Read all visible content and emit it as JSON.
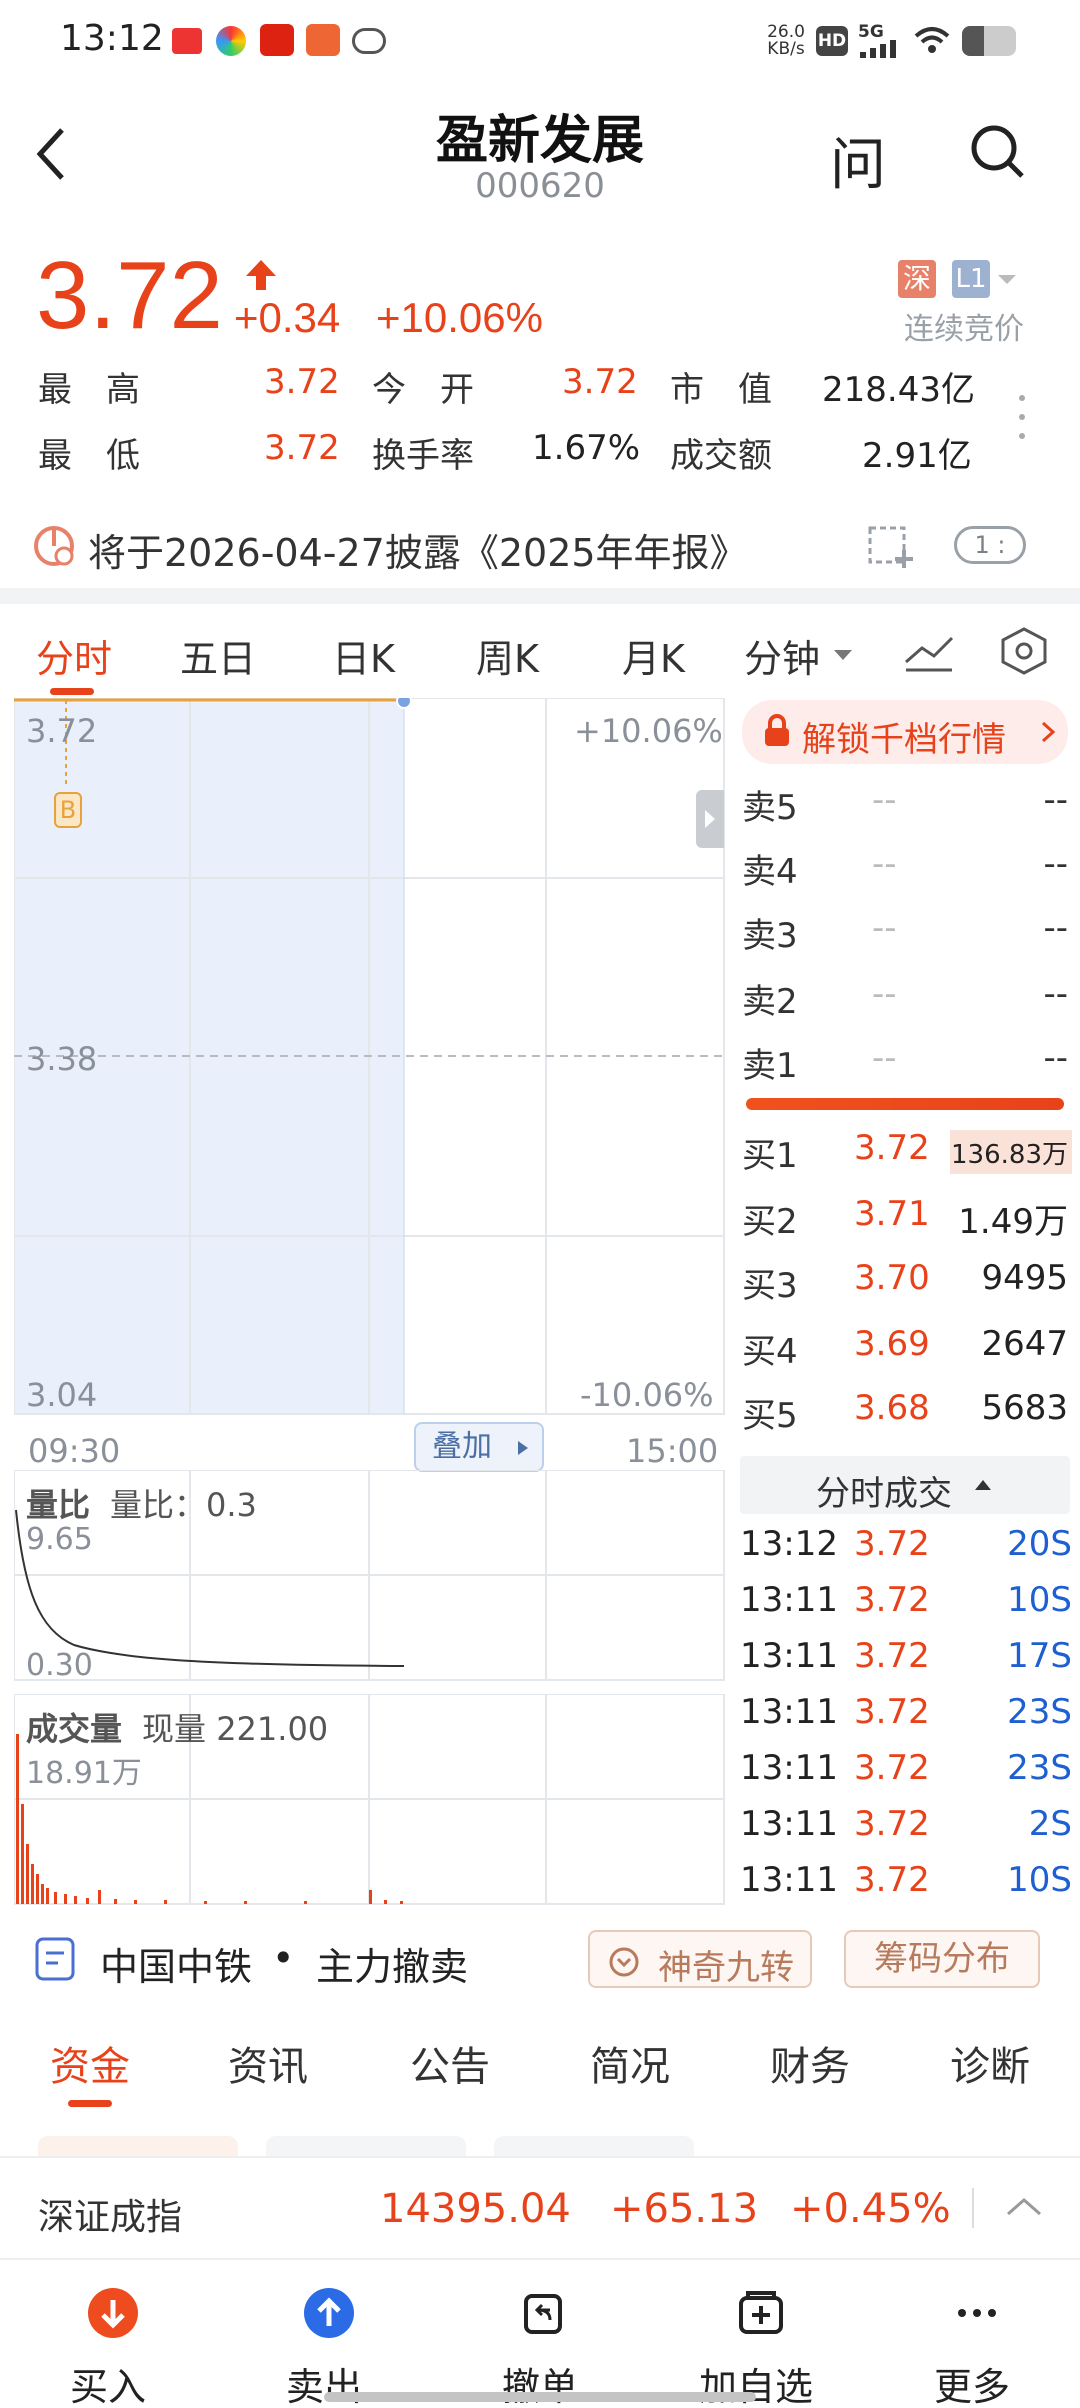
{
  "status": {
    "time": "13:12",
    "net_speed_top": "26.0",
    "net_speed_unit": "KB/s",
    "hd": "HD",
    "signal": "5G"
  },
  "header": {
    "title": "盈新发展",
    "code": "000620",
    "ask_label": "问"
  },
  "quote": {
    "price": "3.72",
    "change": "+0.34",
    "change_pct": "+10.06%",
    "market_tag": "深",
    "level_tag": "L1",
    "trade_mode": "连续竞价",
    "stats": [
      {
        "label": "最　高",
        "value": "3.72",
        "label2": "今　开",
        "value2": "3.72",
        "label3": "市　值",
        "value3": "218.43亿"
      },
      {
        "label": "最　低",
        "value": "3.72",
        "label2": "换手率",
        "value2": "1.67%",
        "label3": "成交额",
        "value3": "2.91亿"
      }
    ]
  },
  "notice": {
    "text": "将于2026-04-27披露《2025年年报》",
    "badge": "1 :"
  },
  "chart_tabs": [
    "分时",
    "五日",
    "日K",
    "周K",
    "月K",
    "分钟"
  ],
  "active_tab": "分时",
  "chart": {
    "y_top": "3.72",
    "y_mid": "3.38",
    "y_bot": "3.04",
    "pct_top": "+10.06%",
    "pct_bot": "-10.06%",
    "time_start": "09:30",
    "time_end": "15:00",
    "overlay_button": "叠加",
    "buy_marker": "B"
  },
  "vol_ratio": {
    "title": "量比",
    "label": "量比：",
    "value": "0.3",
    "max": "9.65",
    "min": "0.30"
  },
  "volume": {
    "title": "成交量",
    "label": "现量",
    "value": "221.00",
    "max": "18.91万"
  },
  "unlock": "解锁千档行情",
  "order_book": {
    "asks": [
      {
        "label": "卖5",
        "price": "--",
        "vol": "--"
      },
      {
        "label": "卖4",
        "price": "--",
        "vol": "--"
      },
      {
        "label": "卖3",
        "price": "--",
        "vol": "--"
      },
      {
        "label": "卖2",
        "price": "--",
        "vol": "--"
      },
      {
        "label": "卖1",
        "price": "--",
        "vol": "--"
      }
    ],
    "bids": [
      {
        "label": "买1",
        "price": "3.72",
        "vol": "136.83万"
      },
      {
        "label": "买2",
        "price": "3.71",
        "vol": "1.49万"
      },
      {
        "label": "买3",
        "price": "3.70",
        "vol": "9495"
      },
      {
        "label": "买4",
        "price": "3.69",
        "vol": "2647"
      },
      {
        "label": "买5",
        "price": "3.68",
        "vol": "5683"
      }
    ]
  },
  "ticks_header": "分时成交",
  "ticks": [
    {
      "time": "13:12",
      "price": "3.72",
      "vol": "20S"
    },
    {
      "time": "13:11",
      "price": "3.72",
      "vol": "10S"
    },
    {
      "time": "13:11",
      "price": "3.72",
      "vol": "17S"
    },
    {
      "time": "13:11",
      "price": "3.72",
      "vol": "23S"
    },
    {
      "time": "13:11",
      "price": "3.72",
      "vol": "23S"
    },
    {
      "time": "13:11",
      "price": "3.72",
      "vol": "2S"
    },
    {
      "time": "13:11",
      "price": "3.72",
      "vol": "10S"
    }
  ],
  "news_bar": {
    "stock": "中国中铁",
    "dot": "•",
    "event": "主力撤卖",
    "btn1": "神奇九转",
    "btn2": "筹码分布"
  },
  "section_tabs": [
    "资金",
    "资讯",
    "公告",
    "简况",
    "财务",
    "诊断"
  ],
  "index_bar": {
    "name": "深证成指",
    "value": "14395.04",
    "change": "+65.13",
    "pct": "+0.45%"
  },
  "bottom_nav": [
    {
      "label": "买入"
    },
    {
      "label": "卖出"
    },
    {
      "label": "撤单"
    },
    {
      "label": "加自选"
    },
    {
      "label": "更多"
    }
  ],
  "colors": {
    "up": "#e8421a",
    "down": "#1a8a3a",
    "accent": "#e8421a",
    "chart_fill": "#e9f0fb"
  }
}
